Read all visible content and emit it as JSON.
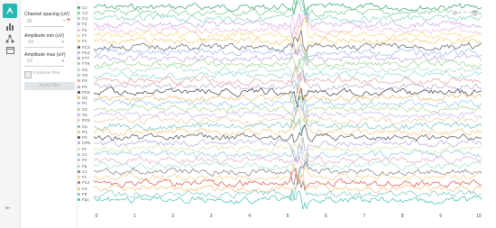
{
  "sidebar": {
    "icons": [
      "brain-icon",
      "bar-chart-icon",
      "network-icon",
      "calendar-icon"
    ],
    "collapse_glyph": "⇤"
  },
  "panel": {
    "channel_spacing_label": "Channel spacing (uV)",
    "channel_spacing_value": "80",
    "amplitude_min_label": "Amplitude min (uV)",
    "amplitude_min_value": "-50",
    "amplitude_max_label": "Amplitude max (uV)",
    "amplitude_max_value": "50",
    "auto_label": "Amplitude filter",
    "apply_label": "Apply filter"
  },
  "toolbar": [
    "refresh-icon",
    "minus-icon",
    "eye-icon"
  ],
  "channels": [
    {
      "name": "Cz",
      "color": "#2e9e6a"
    },
    {
      "name": "C3",
      "color": "#79c98f"
    },
    {
      "name": "C4",
      "color": "#7fd3c2"
    },
    {
      "name": "F3",
      "color": "#c9a3e6"
    },
    {
      "name": "F4",
      "color": "#f0b7e0"
    },
    {
      "name": "F7",
      "color": "#f4d77a"
    },
    {
      "name": "Fz",
      "color": "#f5c96b"
    },
    {
      "name": "FC3",
      "color": "#5a5a66"
    },
    {
      "name": "FC4",
      "color": "#9fb7e8"
    },
    {
      "name": "FT7",
      "color": "#b9a0e0"
    },
    {
      "name": "FT8",
      "color": "#9bd08a"
    },
    {
      "name": "O1",
      "color": "#a8dcc8"
    },
    {
      "name": "O2",
      "color": "#8fd6d6"
    },
    {
      "name": "P3",
      "color": "#e8a0a0"
    },
    {
      "name": "P4",
      "color": "#b8a8c8"
    },
    {
      "name": "POz",
      "color": "#3a3a48"
    },
    {
      "name": "Oz",
      "color": "#e6b86b"
    },
    {
      "name": "Pz",
      "color": "#8fc7e8"
    },
    {
      "name": "Oz",
      "color": "#a9d48c"
    },
    {
      "name": "Oz",
      "color": "#c6b7e6"
    },
    {
      "name": "POz",
      "color": "#e9c9a0"
    },
    {
      "name": "Cp",
      "color": "#6cc2c0"
    },
    {
      "name": "P4",
      "color": "#f2c77a"
    },
    {
      "name": "P4",
      "color": "#4b4b56"
    },
    {
      "name": "CP5",
      "color": "#b6a4e2"
    },
    {
      "name": "Fz",
      "color": "#cfe6a0"
    },
    {
      "name": "Cz",
      "color": "#93c6e6"
    },
    {
      "name": "Pz",
      "color": "#e6a6c6"
    },
    {
      "name": "Fp",
      "color": "#a0e0c8"
    },
    {
      "name": "Cz",
      "color": "#7a7a86"
    },
    {
      "name": "Fz",
      "color": "#f1d08a"
    },
    {
      "name": "FCz",
      "color": "#d8524a"
    },
    {
      "name": "F4",
      "color": "#f2c27a"
    },
    {
      "name": "F8",
      "color": "#7dc6c2"
    },
    {
      "name": "Fpz",
      "color": "#3fbfb0"
    }
  ],
  "chart_data": {
    "type": "line",
    "x_ticks": [
      "0",
      "1",
      "2",
      "3",
      "4",
      "5",
      "6",
      "7",
      "8",
      "9",
      "10"
    ],
    "x_range": [
      0,
      10
    ],
    "artifact_at": [
      5.1,
      5.5
    ]
  }
}
